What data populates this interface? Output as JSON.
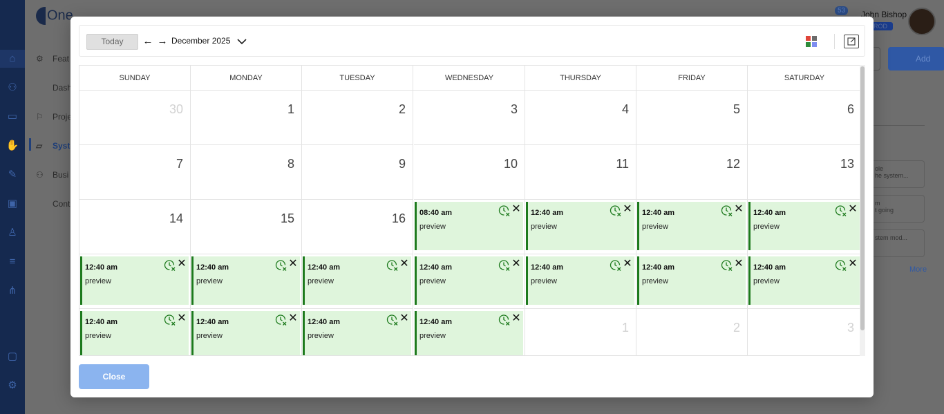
{
  "background": {
    "logo": "One",
    "nav": [
      "Feat",
      "Dash",
      "Proje",
      "Syste",
      "Busi",
      "Cont"
    ],
    "user_name": "John Bishop",
    "role_badge": "ROD",
    "notification_count": "53",
    "add_label": "Add",
    "cards": [
      "ole",
      "he system...",
      "m",
      "t going",
      "stem mod..."
    ],
    "more_label": "More"
  },
  "toolbar": {
    "today_label": "Today",
    "month_label": "December 2025",
    "prev_icon": "arrow-left-icon",
    "next_icon": "arrow-right-icon"
  },
  "calendar": {
    "weekdays": [
      "SUNDAY",
      "MONDAY",
      "TUESDAY",
      "WEDNESDAY",
      "THURSDAY",
      "FRIDAY",
      "SATURDAY"
    ],
    "weeks": [
      [
        {
          "day": "30",
          "muted": true
        },
        {
          "day": "1"
        },
        {
          "day": "2"
        },
        {
          "day": "3"
        },
        {
          "day": "4"
        },
        {
          "day": "5"
        },
        {
          "day": "6"
        }
      ],
      [
        {
          "day": "7"
        },
        {
          "day": "8"
        },
        {
          "day": "9"
        },
        {
          "day": "10"
        },
        {
          "day": "11"
        },
        {
          "day": "12"
        },
        {
          "day": "13"
        }
      ],
      [
        {
          "day": "14"
        },
        {
          "day": "15"
        },
        {
          "day": "16"
        },
        {
          "event": {
            "time": "08:40 am",
            "title": "preview"
          }
        },
        {
          "event": {
            "time": "12:40 am",
            "title": "preview"
          }
        },
        {
          "event": {
            "time": "12:40 am",
            "title": "preview"
          }
        },
        {
          "event": {
            "time": "12:40 am",
            "title": "preview"
          }
        }
      ],
      [
        {
          "event": {
            "time": "12:40 am",
            "title": "preview"
          }
        },
        {
          "event": {
            "time": "12:40 am",
            "title": "preview"
          }
        },
        {
          "event": {
            "time": "12:40 am",
            "title": "preview"
          }
        },
        {
          "event": {
            "time": "12:40 am",
            "title": "preview"
          }
        },
        {
          "event": {
            "time": "12:40 am",
            "title": "preview"
          }
        },
        {
          "event": {
            "time": "12:40 am",
            "title": "preview"
          }
        },
        {
          "event": {
            "time": "12:40 am",
            "title": "preview"
          }
        }
      ],
      [
        {
          "event": {
            "time": "12:40 am",
            "title": "preview"
          }
        },
        {
          "event": {
            "time": "12:40 am",
            "title": "preview"
          }
        },
        {
          "event": {
            "time": "12:40 am",
            "title": "preview"
          }
        },
        {
          "event": {
            "time": "12:40 am",
            "title": "preview"
          }
        },
        {
          "day": "1",
          "muted": true
        },
        {
          "day": "2",
          "muted": true
        },
        {
          "day": "3",
          "muted": true
        }
      ]
    ]
  },
  "footer": {
    "close_label": "Close"
  },
  "colors": {
    "event_bg": "#dff5dc",
    "event_border": "#1d7a1d",
    "close_button": "#8bb4ef",
    "palette": [
      "#e0453a",
      "#6b6b6b",
      "#2e8b3a",
      "#7d8df0"
    ]
  }
}
